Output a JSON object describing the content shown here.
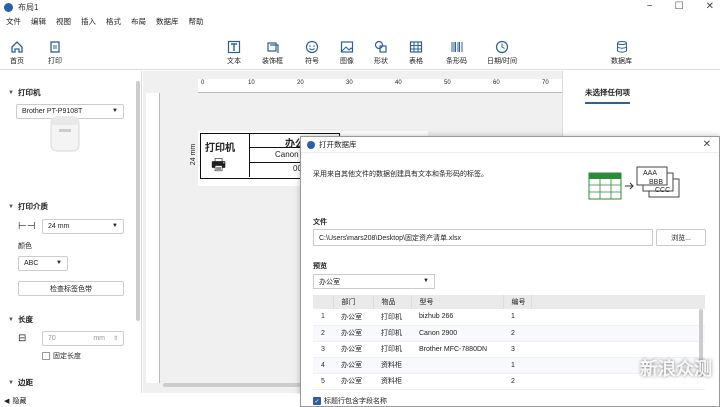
{
  "window": {
    "title": "布局1"
  },
  "menu": [
    "文件",
    "编辑",
    "视图",
    "插入",
    "格式",
    "布局",
    "数据库",
    "帮助"
  ],
  "ribbon": {
    "home": "首页",
    "print": "打印",
    "text": "文本",
    "decor": "装饰框",
    "symbol": "符号",
    "image": "图像",
    "shape": "形状",
    "table": "表格",
    "barcode": "条形码",
    "datetime": "日期/时间",
    "database": "数据库"
  },
  "left": {
    "printer_h": "打印机",
    "printer_model": "Brother PT-P9108T",
    "media_h": "打印介质",
    "tape_width": "24 mm",
    "color_h": "颜色",
    "color_value": "ABC",
    "check_tape": "检查标签色带",
    "length_h": "长度",
    "length_value": "70",
    "length_unit": "mm",
    "fixed_length": "固定长度",
    "margin_h": "边距"
  },
  "canvas": {
    "dimension": "24 mm",
    "ruler_ticks": [
      "0",
      "10",
      "20",
      "30",
      "40",
      "50",
      "60",
      "70"
    ],
    "label_text1": "打印机",
    "label_text2": "办公",
    "label_text3": "Canon",
    "label_text4": "00"
  },
  "right": {
    "tab": "未选择任何项"
  },
  "dialog": {
    "title": "打开数据库",
    "description": "采用来自其他文件的数据创建具有文本和条形码的标签。",
    "graphic_text1": "AAA",
    "graphic_text2": "BBB",
    "graphic_text3": "CCC",
    "file_label": "文件",
    "file_path": "C:\\Users\\mars208\\Desktop\\固定资产清单.xlsx",
    "browse": "浏览...",
    "preview_label": "预览",
    "sheet": "办公室",
    "columns": [
      "",
      "部门",
      "物品",
      "型号",
      "编号"
    ],
    "rows": [
      [
        "1",
        "办公室",
        "打印机",
        "bizhub 266",
        "1"
      ],
      [
        "2",
        "办公室",
        "打印机",
        "Canon 2900",
        "2"
      ],
      [
        "3",
        "办公室",
        "打印机",
        "Brother MFC-7880DN",
        "3"
      ],
      [
        "4",
        "办公室",
        "资料柜",
        "",
        "1"
      ],
      [
        "5",
        "办公室",
        "资料柜",
        "",
        "2"
      ]
    ],
    "header_checkbox": "标题行包含字段名称"
  },
  "status": {
    "hide": "隐藏"
  },
  "watermark": "新浪众测"
}
